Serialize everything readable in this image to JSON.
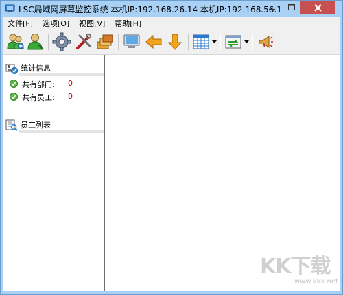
{
  "window": {
    "title": "LSC局域网屏幕监控系统    本机IP:192.168.26.14  本机IP:192.168.56.1"
  },
  "menu": {
    "items": [
      {
        "label": "文件[F]"
      },
      {
        "label": "选项[O]"
      },
      {
        "label": "视图[V]"
      },
      {
        "label": "帮助[H]"
      }
    ]
  },
  "toolbar": {
    "buttons": [
      {
        "icon": "add-users-icon"
      },
      {
        "icon": "user-icon"
      },
      {
        "icon": "gear-icon"
      },
      {
        "icon": "tools-icon"
      },
      {
        "icon": "stack-icon"
      },
      {
        "icon": "monitor-icon"
      },
      {
        "icon": "arrow-left-icon"
      },
      {
        "icon": "arrow-down-icon"
      },
      {
        "icon": "grid-icon"
      },
      {
        "icon": "transfer-icon"
      },
      {
        "icon": "megaphone-icon"
      }
    ]
  },
  "stats": {
    "title": "统计信息",
    "departments_label": "共有部门:",
    "departments_value": "0",
    "employees_label": "共有员工:",
    "employees_value": "0"
  },
  "employees": {
    "title": "员工列表"
  },
  "watermark": {
    "text": "KK下载",
    "url": "www.kkx.net"
  }
}
